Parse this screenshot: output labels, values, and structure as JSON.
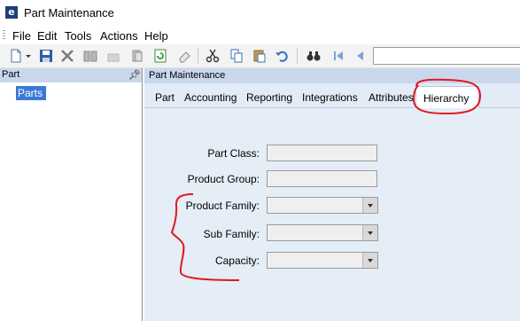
{
  "window": {
    "title": "Part Maintenance"
  },
  "menu": [
    "File",
    "Edit",
    "Tools",
    "Actions",
    "Help"
  ],
  "left_panel": {
    "title": "Part",
    "tree_item": "Parts"
  },
  "main_panel": {
    "title": "Part Maintenance"
  },
  "tabs": [
    {
      "label": "Part"
    },
    {
      "label": "Accounting"
    },
    {
      "label": "Reporting"
    },
    {
      "label": "Integrations"
    },
    {
      "label": "Attributes"
    },
    {
      "label": "Hierarchy",
      "active": true
    }
  ],
  "fields": [
    {
      "label": "Part Class:",
      "type": "text",
      "value": ""
    },
    {
      "label": "Product Group:",
      "type": "text",
      "value": ""
    },
    {
      "label": "Product Family:",
      "type": "select",
      "value": ""
    },
    {
      "label": "Sub Family:",
      "type": "select",
      "value": ""
    },
    {
      "label": "Capacity:",
      "type": "select",
      "value": ""
    }
  ],
  "toolbar_icons": [
    "new-icon",
    "dropdown-arrow-icon",
    "save-icon",
    "delete-icon",
    "book-icon",
    "blank-icon",
    "print-icon",
    "refresh-icon",
    "eraser-icon",
    "cut-icon",
    "copy-icon",
    "paste-icon",
    "undo-icon",
    "binoculars-icon",
    "first-record-icon",
    "previous-record-icon"
  ],
  "colors": {
    "panel_header": "#c9d7ec",
    "main_bg": "#e5edf7",
    "selection": "#3b79d6",
    "annotation": "#e0191e"
  }
}
